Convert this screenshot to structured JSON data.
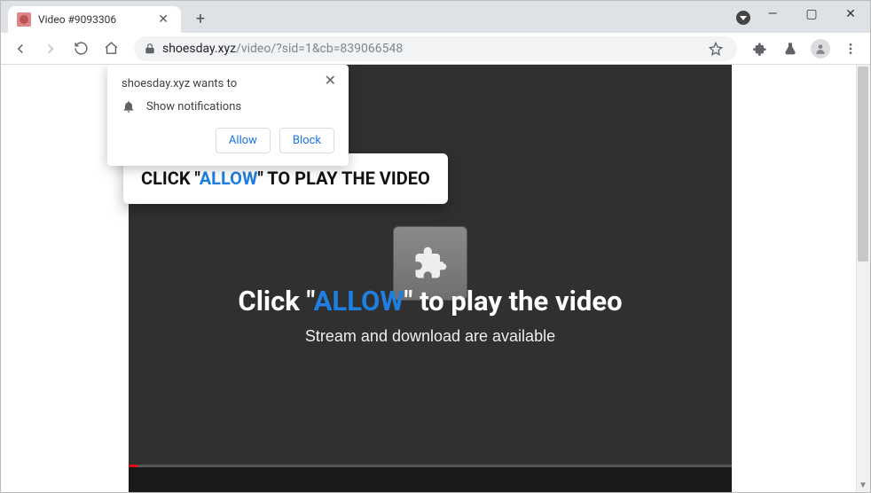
{
  "window": {
    "minimize": "—",
    "maximize": "▢",
    "close": "✕"
  },
  "tab": {
    "title": "Video #9093306",
    "close": "✕",
    "new_tab": "+"
  },
  "toolbar": {
    "url_domain": "shoesday.xyz",
    "url_path": "/video/?sid=1&cb=839066548"
  },
  "permission": {
    "title": "shoesday.xyz wants to",
    "item": "Show notifications",
    "allow": "Allow",
    "block": "Block",
    "close": "✕"
  },
  "callout": {
    "pre": "CLICK \"",
    "word": "ALLOW",
    "post": "\" TO PLAY THE VIDEO"
  },
  "page": {
    "headline_pre": "Click \"",
    "headline_word": "ALLOW",
    "headline_post": "\" to play the video",
    "subline": "Stream and download are available"
  },
  "colors": {
    "accent": "#1e7fe0",
    "chrome_blue": "#1a73e8",
    "video_bg": "#303030"
  }
}
